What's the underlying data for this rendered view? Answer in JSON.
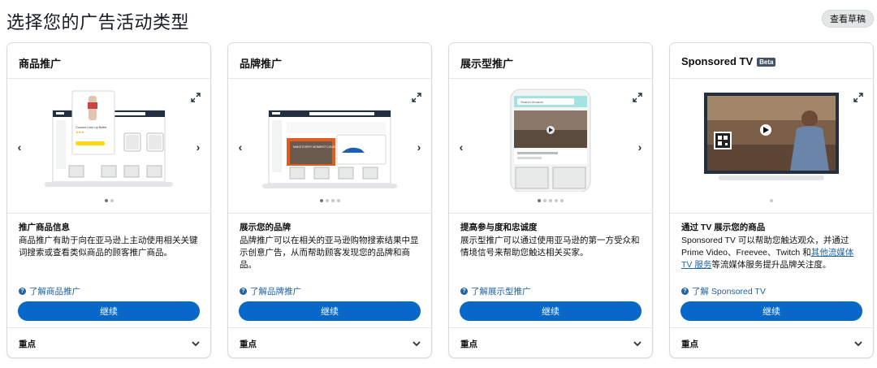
{
  "page": {
    "title": "选择您的广告活动类型",
    "drafts_button": "查看草稿"
  },
  "cards": [
    {
      "title": "商品推广",
      "beta": "",
      "dots_total": 2,
      "dots_active": 0,
      "desc_title": "推广商品信息",
      "desc": "商品推广有助于向在亚马逊上主动使用相关关键词搜索或查看类似商品的顾客推广商品。",
      "learn_more": "了解商品推广",
      "continue": "继续",
      "footer": "重点"
    },
    {
      "title": "品牌推广",
      "beta": "",
      "dots_total": 4,
      "dots_active": 0,
      "desc_title": "展示您的品牌",
      "desc": "品牌推广可以在相关的亚马逊购物搜索结果中显示创意广告，从而帮助顾客发现您的品牌和商品。",
      "learn_more": "了解品牌推广",
      "continue": "继续",
      "footer": "重点"
    },
    {
      "title": "展示型推广",
      "beta": "",
      "dots_total": 5,
      "dots_active": 0,
      "desc_title": "提高参与度和忠诚度",
      "desc": "展示型推广可以通过使用亚马逊的第一方受众和情境信号来帮助您触达相关买家。",
      "learn_more": "了解展示型推广",
      "continue": "继续",
      "footer": "重点"
    },
    {
      "title": "Sponsored TV",
      "beta": "Beta",
      "dots_total": 1,
      "dots_active": 0,
      "desc_title": "通过 TV 展示您的商品",
      "desc_before": "Sponsored TV 可以帮助您触达观众，并通过 Prime Video、Freevee、Twitch 和",
      "desc_link": "其他流媒体 TV 服务",
      "desc_after": "等流媒体服务提升品牌关注度。",
      "learn_more": "了解 Sponsored TV",
      "continue": "继续",
      "footer": "重点"
    }
  ],
  "icons": {
    "expand": "expand-icon",
    "prev": "chevron-left-icon",
    "next": "chevron-right-icon",
    "help": "help-circle-icon",
    "chevron_down": "chevron-down-icon"
  },
  "illus_text": {
    "card1_product": "Coconut Lime Lip Butter",
    "card2_banner": "MAKE EVERY MOMENT COUNT",
    "card3_search": "Search Amazon"
  },
  "colors": {
    "primary_button": "#0868c7",
    "link": "#2162a1",
    "amazon_dark": "#232f3e"
  }
}
